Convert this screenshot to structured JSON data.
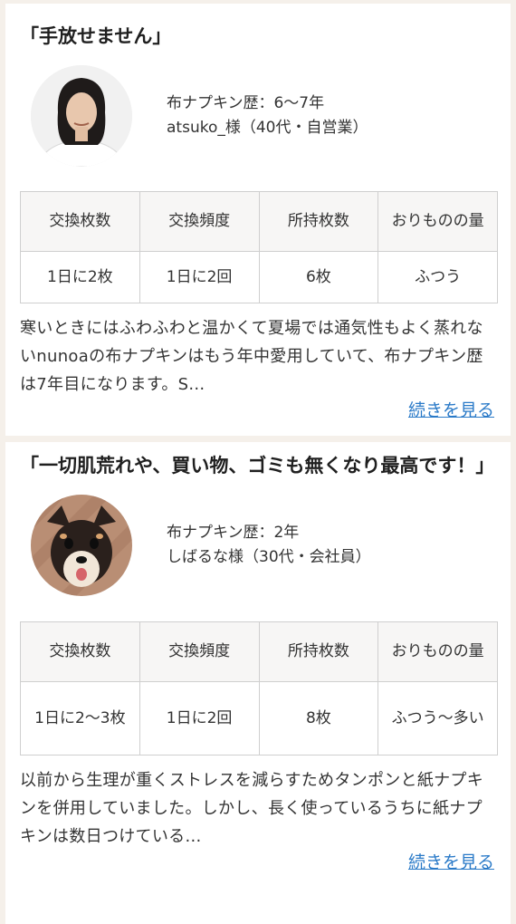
{
  "reviews": [
    {
      "title": "「手放せません」",
      "history": "布ナプキン歴：6〜7年",
      "user": "atsuko_様（40代・自営業）",
      "headers": [
        "交換枚数",
        "交換頻度",
        "所持枚数",
        "おりものの量"
      ],
      "values": [
        "1日に2枚",
        "1日に2回",
        "6枚",
        "ふつう"
      ],
      "text": "寒いときにはふわふわと温かくて夏場では通気性もよく蒸れないnunoaの布ナプキンはもう年中愛用していて、布ナプキン歴は7年目になります。S...",
      "more": "続きを見る"
    },
    {
      "title": "「一切肌荒れや、買い物、ゴミも無くなり最高です！」",
      "history": "布ナプキン歴：2年",
      "user": "しばるな様（30代・会社員）",
      "headers": [
        "交換枚数",
        "交換頻度",
        "所持枚数",
        "おりものの量"
      ],
      "values": [
        "1日に2〜3枚",
        "1日に2回",
        "8枚",
        "ふつう〜多い"
      ],
      "text": "以前から生理が重くストレスを減らすためタンポンと紙ナプキンを併用していました。しかし、長く使っているうちに紙ナプキンは数日つけている...",
      "more": "続きを見る"
    }
  ]
}
